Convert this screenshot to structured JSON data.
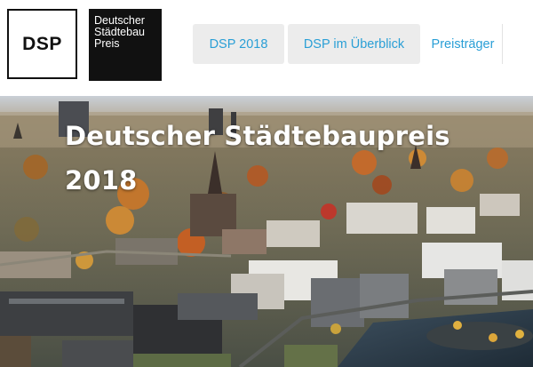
{
  "logos": {
    "short": "DSP",
    "full_lines": [
      "Deutscher",
      "Städtebau",
      "Preis"
    ]
  },
  "nav": {
    "items": [
      {
        "label": "DSP 2018"
      },
      {
        "label": "DSP im Überblick"
      },
      {
        "label": "Preisträger"
      }
    ]
  },
  "hero": {
    "title_line1": "Deutscher Städtebaupreis",
    "title_line2": "2018"
  },
  "colors": {
    "link": "#2a9fd6",
    "nav_bg": "#ececec",
    "logo_black": "#111111"
  }
}
